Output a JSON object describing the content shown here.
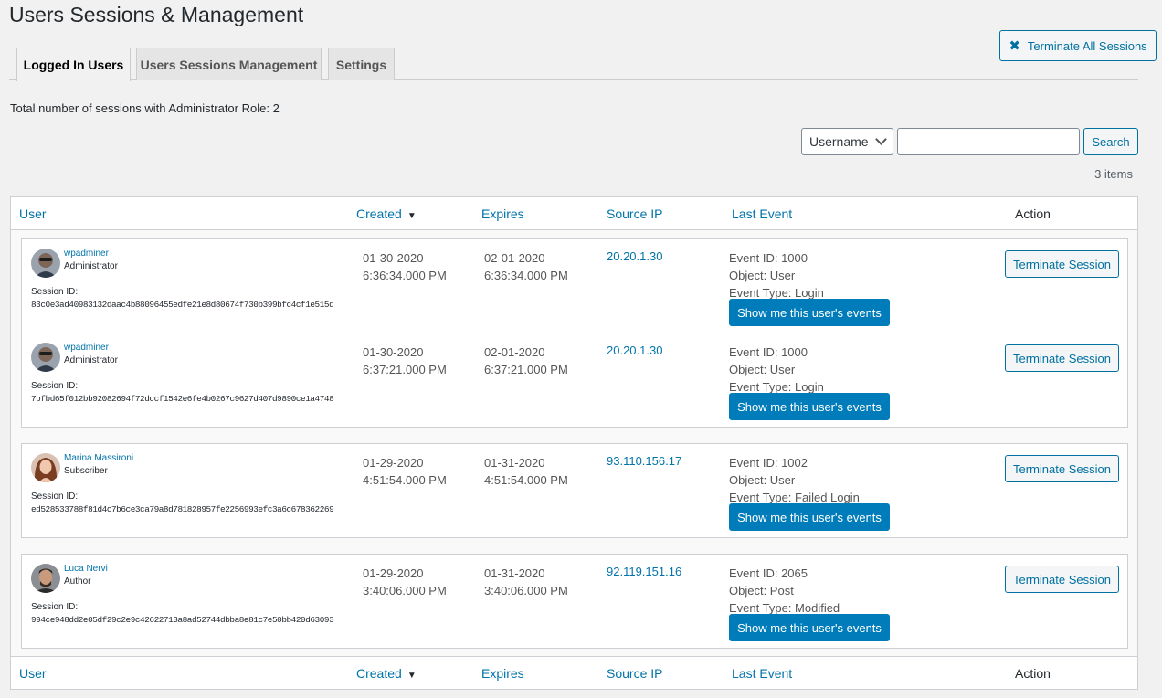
{
  "page": {
    "title": "Users Sessions & Management",
    "terminate_all_label": "Terminate All Sessions"
  },
  "tabs": [
    {
      "label": "Logged In Users",
      "active": true
    },
    {
      "label": "Users Sessions Management",
      "active": false
    },
    {
      "label": "Settings",
      "active": false
    }
  ],
  "summary": {
    "label": "Total number of sessions with Administrator Role:",
    "count": "2"
  },
  "filter": {
    "selected": "Username",
    "search_value": "",
    "search_label": "Search",
    "items_count": "3 items"
  },
  "columns": {
    "user": "User",
    "created": "Created",
    "expires": "Expires",
    "source_ip": "Source IP",
    "last_event": "Last Event",
    "action": "Action",
    "sort_icon": "triangle-down-icon"
  },
  "labels": {
    "session_id": "Session ID:",
    "show_events": "Show me this user's events",
    "terminate": "Terminate Session"
  },
  "sessions": [
    {
      "user": "wpadminer",
      "role": "Administrator",
      "session_id": "83c0e3ad40983132daac4b88096455edfe21e8d80674f730b399bfc4cf1e515d",
      "created_date": "01-30-2020",
      "created_time": "6:36:34.000 PM",
      "expires_date": "02-01-2020",
      "expires_time": "6:36:34.000 PM",
      "ip": "20.20.1.30",
      "event_id": "Event ID: 1000",
      "object": "Object: User",
      "event_type": "Event Type: Login"
    },
    {
      "user": "wpadminer",
      "role": "Administrator",
      "session_id": "7bfbd65f012bb92082694f72dccf1542e6fe4b0267c9627d407d9890ce1a4748",
      "created_date": "01-30-2020",
      "created_time": "6:37:21.000 PM",
      "expires_date": "02-01-2020",
      "expires_time": "6:37:21.000 PM",
      "ip": "20.20.1.30",
      "event_id": "Event ID: 1000",
      "object": "Object: User",
      "event_type": "Event Type: Login"
    },
    {
      "user": "Marina Massironi",
      "role": "Subscriber",
      "session_id": "ed528533788f81d4c7b6ce3ca79a8d781828957fe2256993efc3a6c678362269",
      "created_date": "01-29-2020",
      "created_time": "4:51:54.000 PM",
      "expires_date": "01-31-2020",
      "expires_time": "4:51:54.000 PM",
      "ip": "93.110.156.17",
      "event_id": "Event ID: 1002",
      "object": "Object: User",
      "event_type": "Event Type: Failed Login"
    },
    {
      "user": "Luca Nervi",
      "role": "Author",
      "session_id": "994ce948dd2e05df29c2e9c42622713a8ad52744dbba8e81c7e50bb420d63093",
      "created_date": "01-29-2020",
      "created_time": "3:40:06.000 PM",
      "expires_date": "01-31-2020",
      "expires_time": "3:40:06.000 PM",
      "ip": "92.119.151.16",
      "event_id": "Event ID: 2065",
      "object": "Object: Post",
      "event_type": "Event Type: Modified"
    }
  ],
  "colors": {
    "accent": "#0073aa",
    "primary_button": "#007cba"
  }
}
